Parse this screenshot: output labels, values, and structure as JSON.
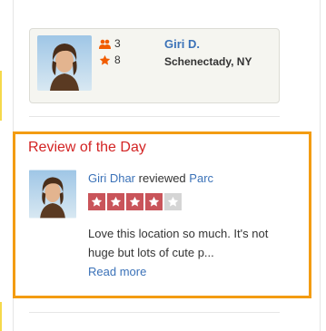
{
  "user_card": {
    "friends_count": "3",
    "reviews_count": "8",
    "name": "Giri D.",
    "location": "Schenectady, NY"
  },
  "review_of_day": {
    "title": "Review of the Day",
    "reviewer": "Giri Dhar",
    "action": "reviewed",
    "business": "Parc",
    "rating": 4,
    "rating_max": 5,
    "text": "Love this location so much. It's not huge but lots of cute p...",
    "read_more": "Read more"
  },
  "colors": {
    "accent_border": "#f39c12",
    "title_red": "#d32323",
    "link_blue": "#3b72b8",
    "star_on": "#c9545a",
    "star_off": "#d5d5d5"
  },
  "icons": {
    "friends": "friends-icon",
    "reviews": "star-icon"
  }
}
